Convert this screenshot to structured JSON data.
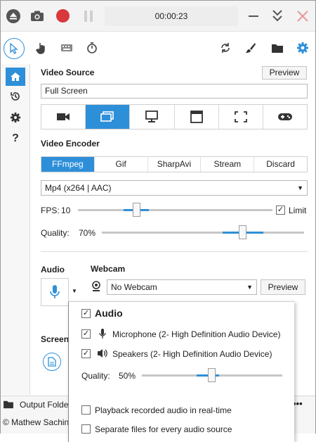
{
  "colors": {
    "accent": "#2e8fd9",
    "record": "#d9383c",
    "close": "#e06060"
  },
  "topbar": {
    "timer": "00:00:23",
    "icons": [
      "eject-icon",
      "camera-icon",
      "record-icon",
      "pause-icon",
      "minimize-icon",
      "collapse-icon",
      "close-icon"
    ]
  },
  "toolbar": {
    "left_icons": [
      "cursor-icon",
      "click-icon",
      "keyboard-icon",
      "timer-icon"
    ],
    "right_icons": [
      "refresh-icon",
      "brush-icon",
      "folder-icon",
      "gear-icon"
    ]
  },
  "sidebar": {
    "items": [
      "home-icon",
      "history-icon",
      "settings-icon",
      "help-icon"
    ],
    "help_label": "?"
  },
  "video_source": {
    "title": "Video Source",
    "preview_label": "Preview",
    "value": "Full Screen",
    "selected_index": 1,
    "buttons": [
      "video-camera-icon",
      "screen-icon",
      "monitor-icon",
      "window-icon",
      "region-icon",
      "gamepad-icon"
    ]
  },
  "video_encoder": {
    "title": "Video Encoder",
    "tabs": [
      "FFmpeg",
      "Gif",
      "SharpAvi",
      "Stream",
      "Discard"
    ],
    "selected_tab": 0,
    "codec": "Mp4 (x264 | AAC)",
    "fps_label": "FPS:",
    "fps_value": "10",
    "fps_level": 0.29,
    "limit_label": "Limit",
    "limit_checked": true,
    "quality_label": "Quality:",
    "quality_value": "70%",
    "quality_level": 0.7
  },
  "audio": {
    "title": "Audio",
    "popup": {
      "title": "Audio",
      "microphone_label": "Microphone (2- High Definition Audio Device)",
      "speakers_label": "Speakers (2- High Definition Audio Device)",
      "quality_label": "Quality:",
      "quality_value": "50%",
      "quality_level": 0.5,
      "playback_label": "Playback recorded audio in real-time",
      "separate_label": "Separate files for every audio source"
    }
  },
  "webcam": {
    "title": "Webcam",
    "value": "No Webcam",
    "preview_label": "Preview"
  },
  "screenshot": {
    "title": "Screens"
  },
  "status": {
    "output_label": "Output Folde",
    "more_label": "•••",
    "copyright": "© Mathew Sachin"
  }
}
